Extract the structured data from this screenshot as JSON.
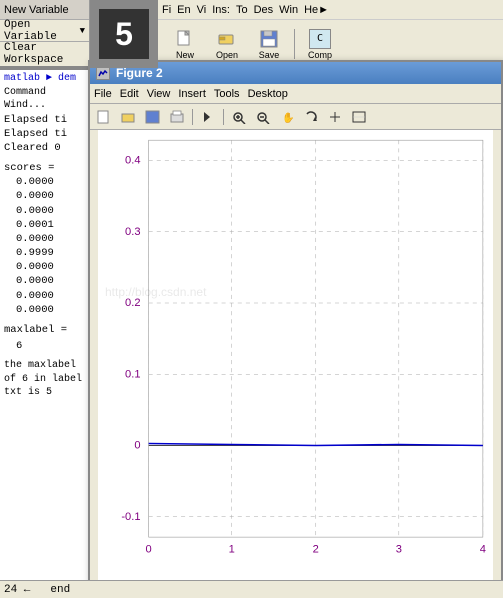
{
  "leftPanel": {
    "newVariable": "New Variable",
    "openVariable": "Open Variable",
    "clearWorkspace": "Clear Workspace"
  },
  "commandWindow": {
    "tabLabel": "Command Wind...",
    "path": "matlab ► dem",
    "lines": [
      "Elapsed ti",
      "Elapsed ti",
      "Cleared 0"
    ],
    "scoresLabel": "scores =",
    "scoresValues": [
      "0.0000",
      "0.0000",
      "0.0000",
      "0.0001",
      "0.0000",
      "0.9999",
      "0.0000",
      "0.0000",
      "0.0000",
      "0.0000"
    ],
    "maxlabelLabel": "maxlabel =",
    "maxlabelValue": "6",
    "finalLine": "the maxlabel of 6 in label txt is 5"
  },
  "figure2": {
    "title": "Figure 2",
    "menus": [
      "File",
      "Edit",
      "View",
      "Insert",
      "Tools",
      "Desktop"
    ],
    "yAxisLabels": [
      "0.4",
      "0.3",
      "0.2",
      "0.1",
      "0",
      "-0.1"
    ],
    "xAxisLabels": [
      "0",
      "1",
      "2",
      "3",
      "4"
    ],
    "thumbnail": "5"
  },
  "matlab": {
    "menuItems": [
      "Fi",
      "En",
      "Vi",
      "Ins:",
      "To",
      "Des",
      "Win",
      "He►"
    ],
    "toolButtons": [
      "New",
      "Open",
      "Save",
      "Comp"
    ],
    "statusLeft": "24 ←",
    "statusRight": "end"
  },
  "watermark": "http://blog.csdn.net"
}
